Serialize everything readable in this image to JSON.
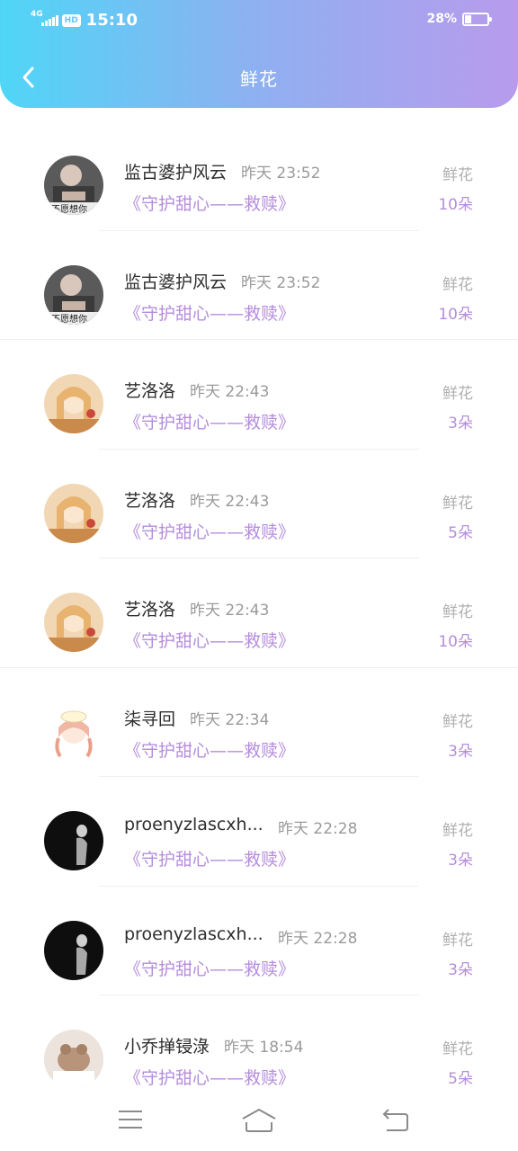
{
  "status_bar": {
    "network": "4G",
    "hd": "HD",
    "time": "15:10",
    "battery": "28%",
    "battery_level": 0.28
  },
  "header": {
    "title": "鲜花",
    "back_icon": "chevron-left-icon"
  },
  "gift_label": "鲜花",
  "items": [
    {
      "user": "监古婆护风云",
      "time": "昨天 23:52",
      "book": "《守护甜心——救赎》",
      "count": "10朵",
      "avatar": "avatar-photo-1"
    },
    {
      "user": "监古婆护风云",
      "time": "昨天 23:52",
      "book": "《守护甜心——救赎》",
      "count": "10朵",
      "avatar": "avatar-photo-1"
    },
    {
      "user": "艺洛洛",
      "time": "昨天 22:43",
      "book": "《守护甜心——救赎》",
      "count": "3朵",
      "avatar": "avatar-anime-1"
    },
    {
      "user": "艺洛洛",
      "time": "昨天 22:43",
      "book": "《守护甜心——救赎》",
      "count": "5朵",
      "avatar": "avatar-anime-1"
    },
    {
      "user": "艺洛洛",
      "time": "昨天 22:43",
      "book": "《守护甜心——救赎》",
      "count": "10朵",
      "avatar": "avatar-anime-1"
    },
    {
      "user": "柒寻回",
      "time": "昨天 22:34",
      "book": "《守护甜心——救赎》",
      "count": "3朵",
      "avatar": "avatar-anime-2"
    },
    {
      "user": "proenyzlascxh...",
      "time": "昨天 22:28",
      "book": "《守护甜心——救赎》",
      "count": "3朵",
      "avatar": "avatar-dark-photo"
    },
    {
      "user": "proenyzlascxh...",
      "time": "昨天 22:28",
      "book": "《守护甜心——救赎》",
      "count": "3朵",
      "avatar": "avatar-dark-photo"
    },
    {
      "user": "小乔掸锓淥",
      "time": "昨天 18:54",
      "book": "《守护甜心——救赎》",
      "count": "5朵",
      "avatar": "avatar-toy-photo"
    }
  ],
  "nav": {
    "menu_icon": "menu-icon",
    "home_icon": "home-icon",
    "back_icon": "back-icon"
  }
}
